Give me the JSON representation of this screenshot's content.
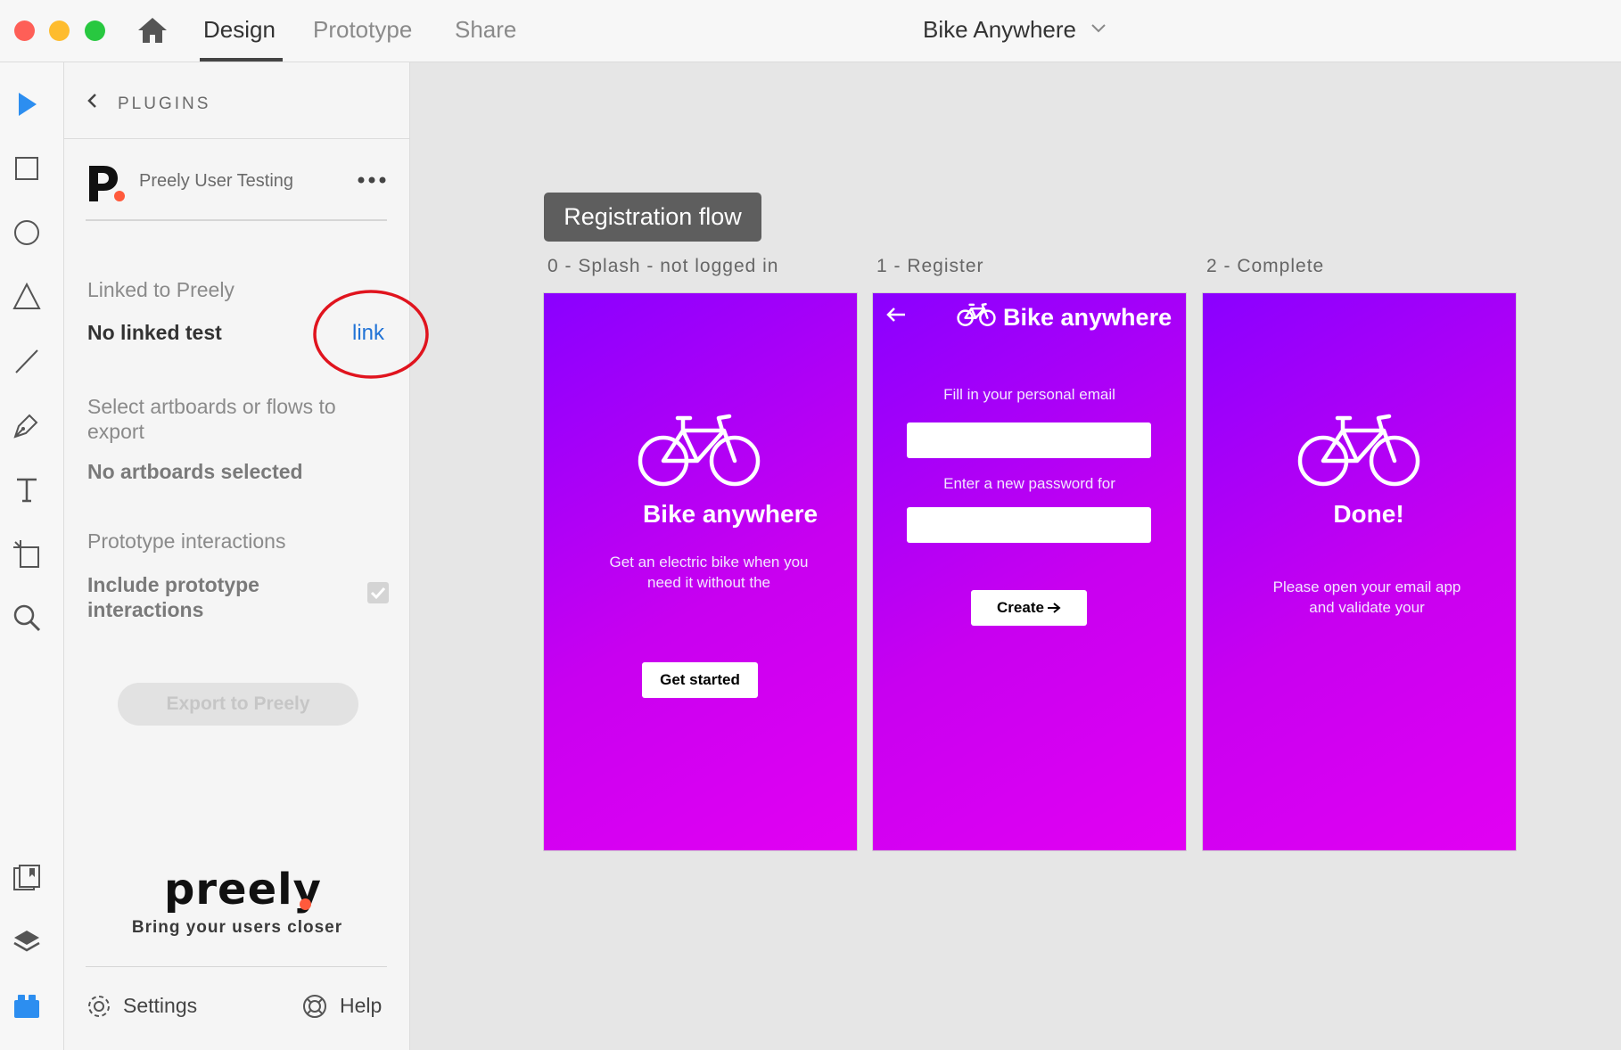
{
  "window": {
    "tabs": [
      {
        "label": "Design",
        "active": true
      },
      {
        "label": "Prototype",
        "active": false
      },
      {
        "label": "Share",
        "active": false
      }
    ],
    "document_title": "Bike Anywhere"
  },
  "toolbar": {
    "tools": [
      "select-tool",
      "rectangle-tool",
      "ellipse-tool",
      "polygon-tool",
      "line-tool",
      "pen-tool",
      "text-tool",
      "artboard-tool",
      "zoom-tool"
    ],
    "bottom_tools": [
      "assets",
      "layers",
      "plugins"
    ]
  },
  "panel": {
    "header": "PLUGINS",
    "plugin_name": "Preely User Testing",
    "linked_label": "Linked to Preely",
    "linked_value": "No linked test",
    "link_label": "link",
    "select_label": "Select artboards or flows to export",
    "select_value": "No artboards selected",
    "interactions_label": "Prototype interactions",
    "interactions_value": "Include prototype interactions",
    "interactions_checked": true,
    "export_button": "Export to Preely",
    "brand": "preely",
    "tagline": "Bring your users closer",
    "settings_label": "Settings",
    "help_label": "Help"
  },
  "canvas": {
    "flow_name": "Registration flow",
    "artboards": [
      {
        "title": "0 - Splash - not logged in",
        "heading": "Bike anywhere",
        "body": "Get an electric bike when you need it without the",
        "button": "Get started"
      },
      {
        "title": "1 - Register",
        "header": "Bike anywhere",
        "email_label": "Fill in your personal email",
        "password_label": "Enter a new password for",
        "button": "Create"
      },
      {
        "title": "2 - Complete",
        "heading": "Done!",
        "body": "Please open your email app and validate your"
      }
    ]
  },
  "colors": {
    "accent_blue": "#2173d6",
    "annotation_red": "#e0141e",
    "brand_orange": "#ff5a3c",
    "gradient_start": "#8a00ff",
    "gradient_end": "#e200f3"
  }
}
